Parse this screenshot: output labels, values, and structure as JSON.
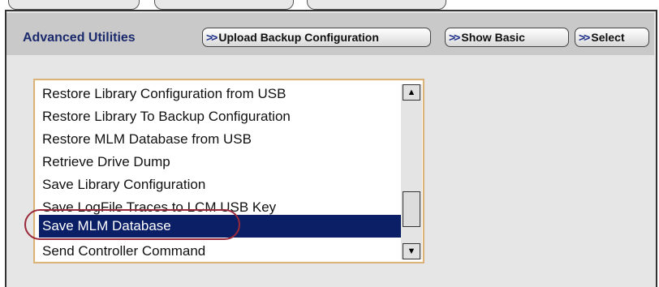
{
  "panel": {
    "title": "Advanced Utilities",
    "buttons": {
      "upload_backup": "Upload Backup Configuration",
      "show_basic": "Show Basic",
      "select": "Select"
    },
    "chevron": ">>"
  },
  "utilities_list": {
    "items": [
      {
        "label": "Restore Library Configuration from USB",
        "selected": false
      },
      {
        "label": "Restore Library To Backup Configuration",
        "selected": false
      },
      {
        "label": "Restore MLM Database from USB",
        "selected": false
      },
      {
        "label": "Retrieve Drive Dump",
        "selected": false
      },
      {
        "label": "Save Library Configuration",
        "selected": false
      },
      {
        "label": "Save LogFile Traces to LCM USB Key",
        "selected": false
      },
      {
        "label": "Save MLM Database",
        "selected": true
      },
      {
        "label": "Send Controller Command",
        "selected": false
      }
    ],
    "scroll_up_icon": "triangle-up-icon",
    "scroll_down_icon": "triangle-down-icon"
  },
  "colors": {
    "selection": "#0b1f66",
    "title": "#1a2a6c",
    "highlight_ring": "#9a2a3a",
    "list_border": "#d9b37a"
  }
}
